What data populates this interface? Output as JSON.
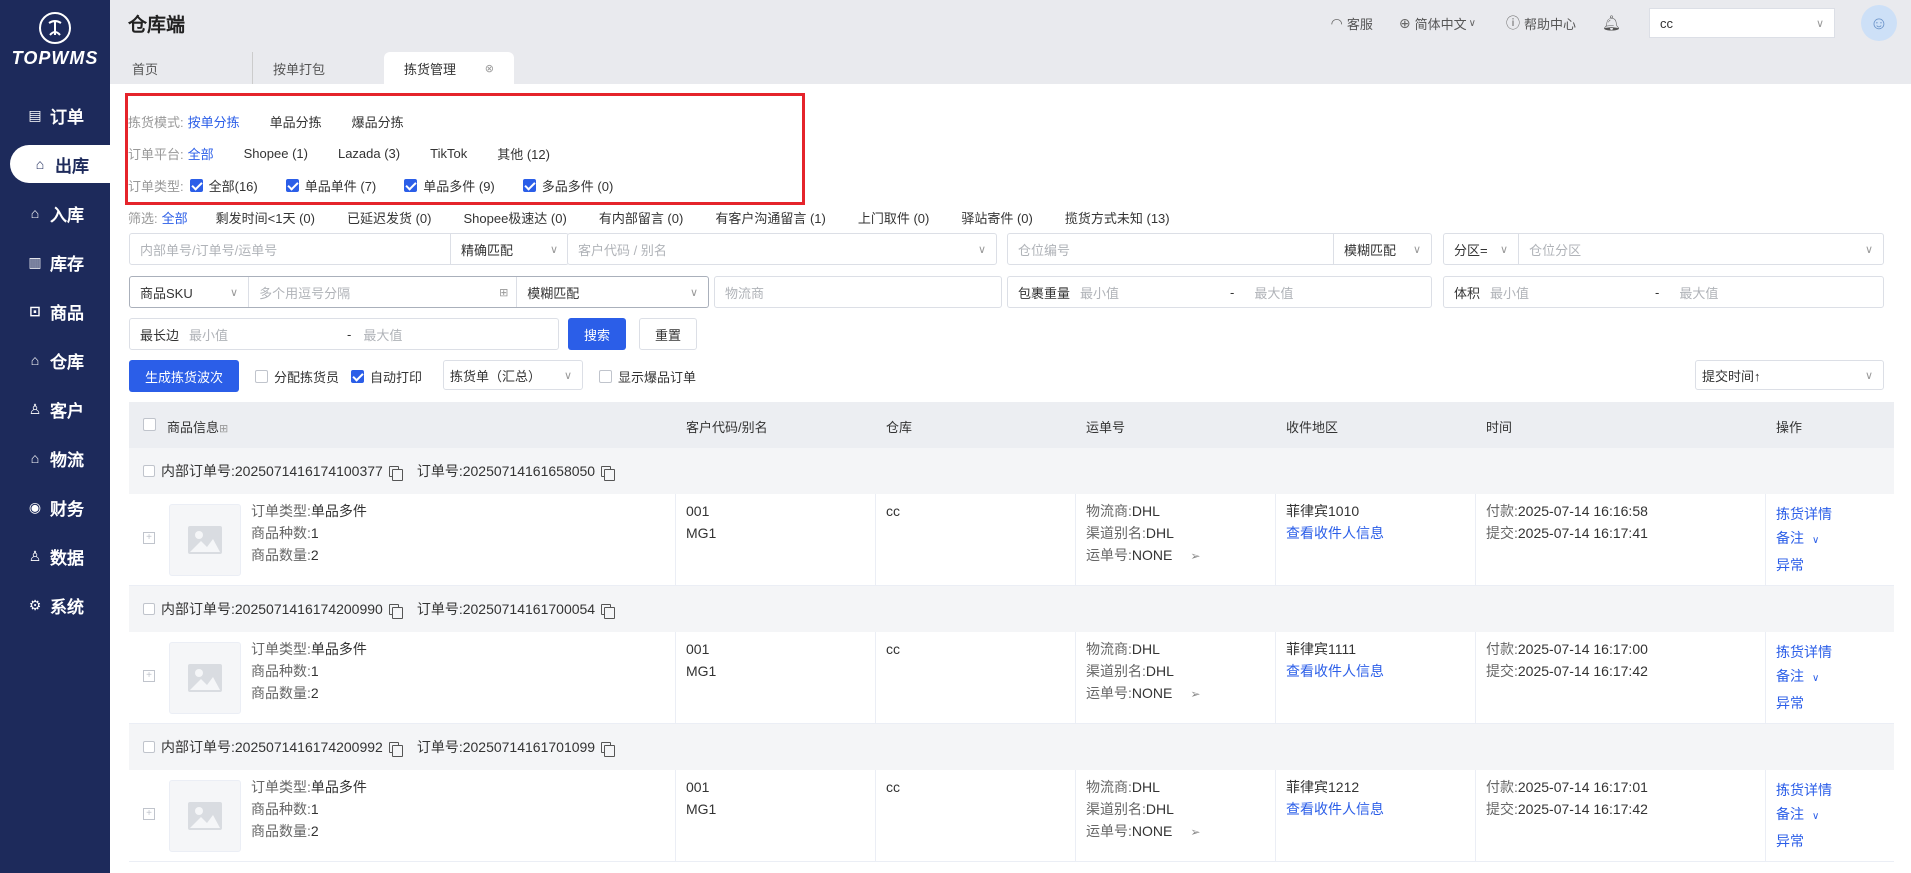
{
  "brand": {
    "name": "TOPWMS"
  },
  "sidebar": {
    "items": [
      {
        "label": "订单",
        "icon": "order-icon"
      },
      {
        "label": "出库",
        "icon": "outbound-icon",
        "active": true
      },
      {
        "label": "入库",
        "icon": "inbound-icon"
      },
      {
        "label": "库存",
        "icon": "inventory-icon"
      },
      {
        "label": "商品",
        "icon": "product-icon"
      },
      {
        "label": "仓库",
        "icon": "warehouse-icon"
      },
      {
        "label": "客户",
        "icon": "customer-icon"
      },
      {
        "label": "物流",
        "icon": "logistics-icon"
      },
      {
        "label": "财务",
        "icon": "finance-icon"
      },
      {
        "label": "数据",
        "icon": "data-icon"
      },
      {
        "label": "系统",
        "icon": "system-icon"
      }
    ]
  },
  "header": {
    "title": "仓库端",
    "service": "客服",
    "language": "简体中文",
    "help": "帮助中心",
    "warehouse_value": "cc"
  },
  "tabs": [
    "首页",
    "按单打包",
    "拣货管理"
  ],
  "filters": {
    "mode": {
      "label": "拣货模式:",
      "options": [
        "按单分拣",
        "单品分拣",
        "爆品分拣"
      ]
    },
    "platform": {
      "label": "订单平台:",
      "options": [
        "全部",
        "Shopee (1)",
        "Lazada (3)",
        "TikTok",
        "其他 (12)"
      ]
    },
    "type": {
      "label": "订单类型:",
      "options": [
        "全部(16)",
        "单品单件 (7)",
        "单品多件 (9)",
        "多品多件 (0)"
      ]
    },
    "screen": {
      "label": "筛选:",
      "options": [
        "全部",
        "剩发时间<1天 (0)",
        "已延迟发货 (0)",
        "Shopee极速达 (0)",
        "有内部留言 (0)",
        "有客户沟通留言 (1)",
        "上门取件 (0)",
        "驿站寄件 (0)",
        "揽货方式未知 (13)"
      ]
    }
  },
  "search": {
    "order_no_placeholder": "内部单号/订单号/运单号",
    "exact_match": "精确匹配",
    "customer_placeholder": "客户代码 / 别名",
    "location_placeholder": "仓位编号",
    "fuzzy_match": "模糊匹配",
    "zone_op": "分区=",
    "zone_placeholder": "仓位分区",
    "sku_select": "商品SKU",
    "sku_placeholder": "多个用逗号分隔",
    "sku_match": "模糊匹配",
    "carrier_placeholder": "物流商",
    "weight_label": "包裹重量",
    "volume_label": "体积",
    "longest_label": "最长边",
    "min_placeholder": "最小值",
    "max_placeholder": "最大值",
    "range_sep": "-",
    "search_btn": "搜索",
    "reset_btn": "重置"
  },
  "actions": {
    "generate_btn": "生成拣货波次",
    "assign_picker": "分配拣货员",
    "auto_print": "自动打印",
    "print_type": "拣货单（汇总）",
    "show_hot": "显示爆品订单",
    "sort": "提交时间↑"
  },
  "table": {
    "columns": [
      "商品信息",
      "客户代码/别名",
      "仓库",
      "运单号",
      "收件地区",
      "时间",
      "操作"
    ],
    "labels": {
      "internal_no": "内部订单号:",
      "order_no": "订单号:",
      "order_type": "订单类型:",
      "sku_kinds": "商品种数:",
      "qty": "商品数量:",
      "carrier": "物流商:",
      "channel": "渠道别名:",
      "waybill": "运单号:",
      "view_recipient": "查看收件人信息",
      "paid": "付款:",
      "submitted": "提交:",
      "detail": "拣货详情",
      "remark": "备注",
      "exception": "异常"
    },
    "rows": [
      {
        "internal_no": "2025071416174100377",
        "order_no": "20250714161658050",
        "order_type": "单品多件",
        "sku_kinds": "1",
        "qty": "2",
        "customer_code": "001",
        "customer_alias": "MG1",
        "warehouse": "cc",
        "carrier": "DHL",
        "channel": "DHL",
        "waybill": "NONE",
        "region": "菲律宾1010",
        "paid": "2025-07-14 16:16:58",
        "submitted": "2025-07-14 16:17:41"
      },
      {
        "internal_no": "2025071416174200990",
        "order_no": "20250714161700054",
        "order_type": "单品多件",
        "sku_kinds": "1",
        "qty": "2",
        "customer_code": "001",
        "customer_alias": "MG1",
        "warehouse": "cc",
        "carrier": "DHL",
        "channel": "DHL",
        "waybill": "NONE",
        "region": "菲律宾1111",
        "paid": "2025-07-14 16:17:00",
        "submitted": "2025-07-14 16:17:42"
      },
      {
        "internal_no": "2025071416174200992",
        "order_no": "20250714161701099",
        "order_type": "单品多件",
        "sku_kinds": "1",
        "qty": "2",
        "customer_code": "001",
        "customer_alias": "MG1",
        "warehouse": "cc",
        "carrier": "DHL",
        "channel": "DHL",
        "waybill": "NONE",
        "region": "菲律宾1212",
        "paid": "2025-07-14 16:17:01",
        "submitted": "2025-07-14 16:17:42"
      }
    ]
  },
  "colors": {
    "sidebar": "#1d2a5b",
    "primary": "#2b5ee8",
    "highlight_box": "#e5242b"
  }
}
